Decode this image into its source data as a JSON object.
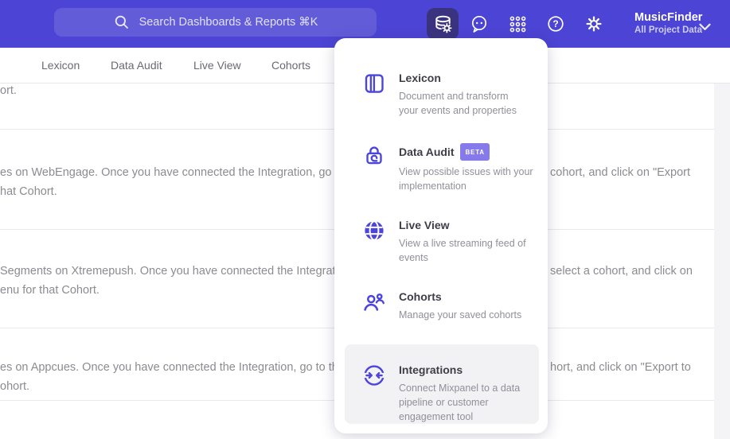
{
  "header": {
    "search_placeholder": "Search Dashboards & Reports ⌘K",
    "project_name": "MusicFinder",
    "project_scope": "All Project Data",
    "icons": [
      "data-management-icon",
      "feedback-bubble-icon",
      "apps-grid-icon",
      "help-icon",
      "settings-gear-icon",
      "chevron-down-icon"
    ],
    "colors": {
      "bar": "#4c44d4",
      "active_icon_bg": "#3a337f"
    }
  },
  "tabs": [
    {
      "label": "Lexicon"
    },
    {
      "label": "Data Audit"
    },
    {
      "label": "Live View"
    },
    {
      "label": "Cohorts"
    }
  ],
  "menu": {
    "accent_color": "#4b44dd",
    "badge_color": "#8679e9",
    "items": [
      {
        "title": "Lexicon",
        "icon": "lexicon-book-icon",
        "description": "Document and transform\nyour events and properties"
      },
      {
        "title": "Data Audit",
        "icon": "data-audit-lock-icon",
        "badge": "BETA",
        "description": "View possible issues with your\nimplementation"
      },
      {
        "title": "Live View",
        "icon": "live-view-globe-icon",
        "description": "View a live streaming feed of\nevents"
      },
      {
        "title": "Cohorts",
        "icon": "cohorts-users-icon",
        "description": "Manage your saved cohorts"
      },
      {
        "title": "Integrations",
        "icon": "integrations-sync-icon",
        "description": "Connect Mixpanel to a data\npipeline or customer\nengagement tool",
        "highlighted": true
      }
    ]
  },
  "background_text": {
    "rows": [
      {
        "left": "ort.",
        "right": ""
      },
      {
        "left": "es on WebEngage. Once you have connected the Integration, go to the\nhat Cohort.",
        "right": "cohort, and click on \"Export"
      },
      {
        "left": "Segments on Xtremepush. Once you have connected the Integration,\nenu for that Cohort.",
        "right": "select a cohort, and click on"
      },
      {
        "left": "es on Appcues. Once you have connected the Integration, go to the M\nohort.",
        "right": "hort, and click on \"Export to"
      }
    ]
  }
}
